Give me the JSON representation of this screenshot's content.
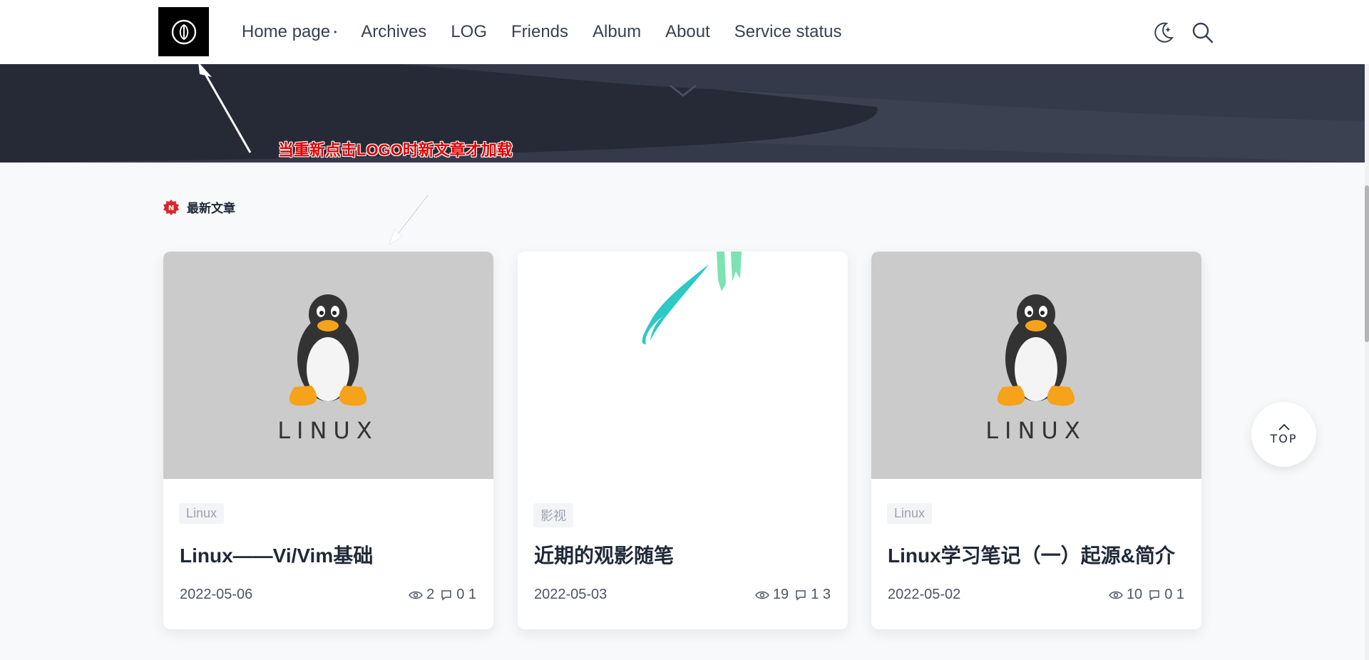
{
  "header": {
    "nav": [
      {
        "label": "Home page",
        "has_dropdown": true
      },
      {
        "label": "Archives"
      },
      {
        "label": "LOG"
      },
      {
        "label": "Friends"
      },
      {
        "label": "Album"
      },
      {
        "label": "About"
      },
      {
        "label": "Service status"
      }
    ],
    "icons": [
      "moon-icon",
      "search-icon"
    ]
  },
  "annotation": {
    "text": "当重新点击LOGO时新文章才加载"
  },
  "section": {
    "title": "最新文章",
    "badge_letter": "N"
  },
  "cards": [
    {
      "thumb": "linux",
      "thumb_text": "LINUX",
      "tag": "Linux",
      "title": "Linux——Vi/Vim基础",
      "date": "2022-05-06",
      "views": "2",
      "comments": "0 1"
    },
    {
      "thumb": "brush",
      "tag": "影视",
      "title": "近期的观影随笔",
      "date": "2022-05-03",
      "views": "19",
      "comments": "1 3"
    },
    {
      "thumb": "linux",
      "thumb_text": "LINUX",
      "tag": "Linux",
      "title": "Linux学习笔记（一）起源&简介",
      "date": "2022-05-02",
      "views": "10",
      "comments": "0 1"
    }
  ],
  "top_button": {
    "label": "TOP"
  },
  "colors": {
    "annotation": "#e00000",
    "badge": "#d9252a",
    "teal": "#2ec8c5",
    "mint": "#7de3b3"
  }
}
